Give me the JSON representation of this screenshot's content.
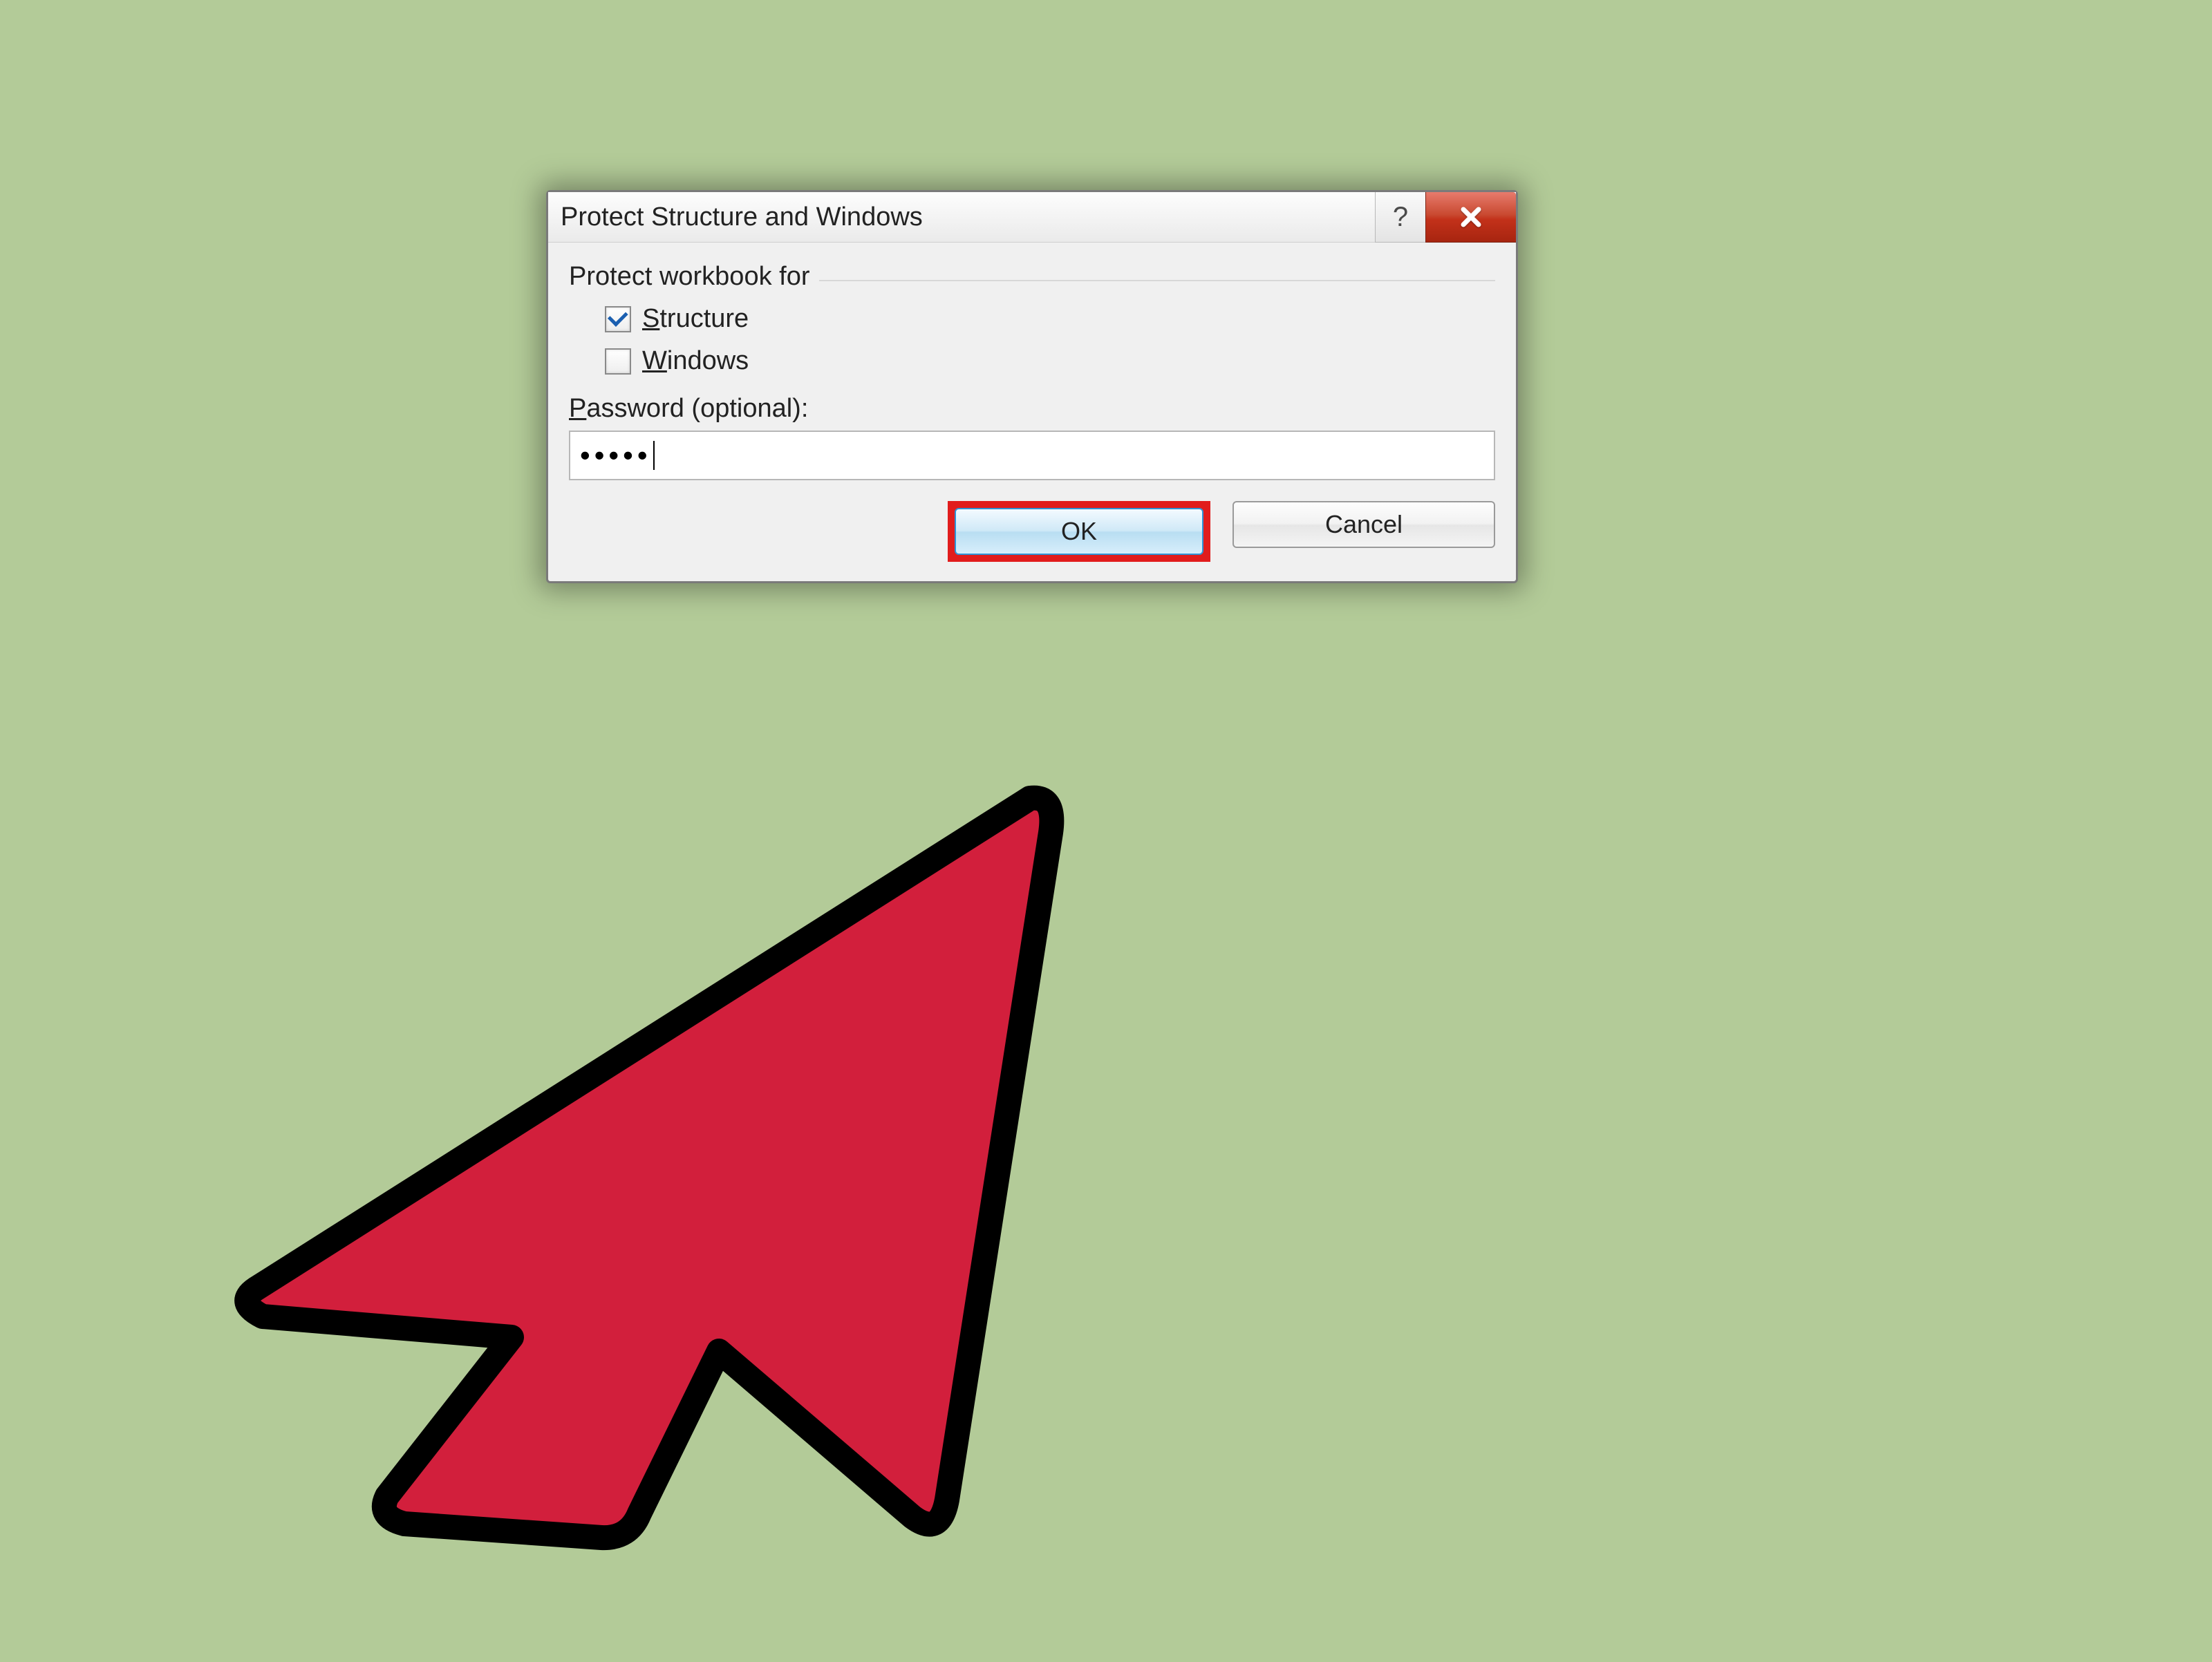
{
  "dialog": {
    "title": "Protect Structure and Windows",
    "group_title": "Protect workbook for",
    "checkboxes": {
      "structure": {
        "label_u": "S",
        "label_rest": "tructure",
        "checked": true
      },
      "windows": {
        "label_u": "W",
        "label_rest": "indows",
        "checked": false
      }
    },
    "password_label_u": "P",
    "password_label_rest": "assword (optional):",
    "password_value": "•••••",
    "ok_label": "OK",
    "cancel_label": "Cancel",
    "help_char": "?",
    "close_char": "x"
  },
  "annotation": {
    "highlight_target": "ok-button",
    "cursor": "large-red-arrow"
  }
}
